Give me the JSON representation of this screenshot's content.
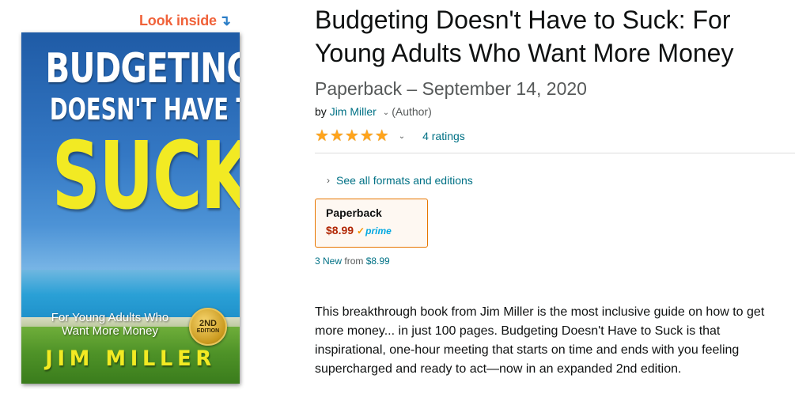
{
  "look_inside": {
    "label": "Look inside",
    "arrow": "↴"
  },
  "cover": {
    "title_line1": "BUDGETING",
    "title_line2": "DOESN'T HAVE TO",
    "title_line3": "SUCK",
    "subtitle_line1": "For Young Adults Who",
    "subtitle_line2": "Want More Money",
    "seal_line1": "2ND",
    "seal_line2": "EDITION",
    "author": "JIM MILLER"
  },
  "product": {
    "title": "Budgeting Doesn't Have to Suck: For Young Adults Who Want More Money",
    "format_date": "Paperback – September 14, 2020",
    "by": "by",
    "author": "Jim Miller",
    "author_role": "(Author)",
    "rating_stars": 5,
    "ratings_count": "4 ratings",
    "formats_link": "See all formats and editions"
  },
  "format_box": {
    "name": "Paperback",
    "price": "$8.99",
    "prime": "prime"
  },
  "offers": {
    "new_count": "3 New",
    "from_label": "from",
    "from_price": "$8.99"
  },
  "description": "This breakthrough book from Jim Miller is the most inclusive guide on how to get more money... in just 100 pages. Budgeting Doesn't Have to Suck is that inspirational, one-hour meeting that starts on time and ends with you feeling supercharged and ready to act—now in an expanded 2nd edition.",
  "colors": {
    "link": "#007185",
    "price": "#b12704",
    "star": "#ffa41c",
    "selected_border": "#e77600",
    "look_inside": "#f0623a"
  }
}
